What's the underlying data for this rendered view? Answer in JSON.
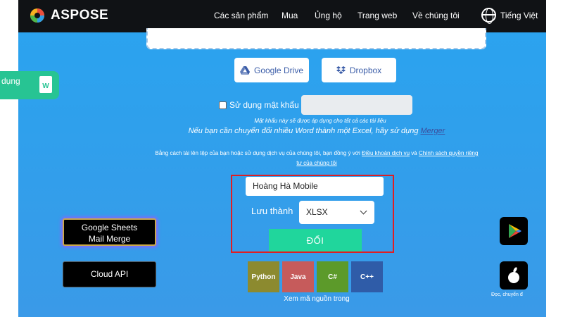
{
  "navbar": {
    "brand": "ASPOSE",
    "items": [
      "Các sản phẩm",
      "Mua",
      "Ủng hộ",
      "Trang web",
      "Về chúng tôi"
    ],
    "language": "Tiếng Việt"
  },
  "sidebar_tab": {
    "label": "dụng",
    "icon": "word-doc-icon"
  },
  "cloud_buttons": {
    "google_drive": "Google Drive",
    "dropbox": "Dropbox"
  },
  "password": {
    "label": "Sử dụng mật khẩu",
    "note": "Mật khẩu này sẽ được áp dụng cho tất cả các tài liệu"
  },
  "merger_note": {
    "text": "Nếu bạn cần chuyển đổi nhiều Word thành một Excel, hãy sử dụng ",
    "link": "Merger"
  },
  "terms": {
    "prefix": "Bằng cách tải lên tệp của bạn hoặc sử dụng dịch vụ của chúng tôi, bạn đồng ý với ",
    "link1": "Điều khoản dịch vụ",
    "mid": " và ",
    "link2": "Chính sách quyền riêng tư của chúng tôi"
  },
  "form": {
    "filename": "Hoàng Hà Mobile",
    "save_label": "Lưu thành",
    "format": "XLSX",
    "convert_label": "ĐỔI"
  },
  "promos": {
    "gs_line1": "Google Sheets",
    "gs_line2": "Mail Merge",
    "api": "Cloud API"
  },
  "code_buttons": [
    {
      "label": "Python",
      "color": "#8c8a2f"
    },
    {
      "label": "Java",
      "color": "#c65b5b"
    },
    {
      "label": "C#",
      "color": "#5c9a2a"
    },
    {
      "label": "C++",
      "color": "#2f5ca8"
    }
  ],
  "code_caption": "Xem mã nguồn trong",
  "store_caption": "Đọc, chuyển đ",
  "colors": {
    "background": "#2fa0ec",
    "accent": "#20d69c",
    "highlight": "#e01e23",
    "navbar": "#101215"
  }
}
